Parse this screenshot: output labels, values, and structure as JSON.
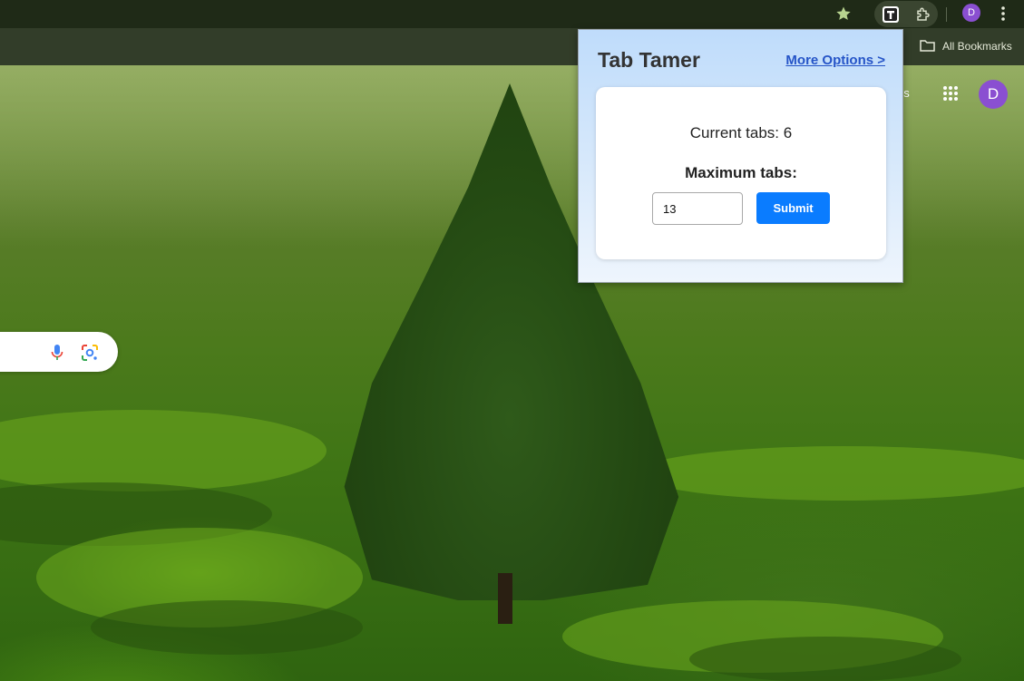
{
  "browser": {
    "bookmarks_label": "All Bookmarks",
    "images_link_fragment": "es",
    "profile_initial": "D",
    "icons": [
      "star-icon",
      "tab-tamer-extension-icon",
      "puzzle-icon",
      "kebab-menu-icon",
      "folder-icon",
      "apps-grid-icon",
      "microphone-icon",
      "google-lens-icon"
    ]
  },
  "popup": {
    "title": "Tab Tamer",
    "more_options": "More Options >",
    "current_tabs": "Current tabs: 6",
    "max_label": "Maximum tabs:",
    "max_value": "13",
    "submit_label": "Submit"
  },
  "colors": {
    "accent": "#0a7cff",
    "link": "#2554c7",
    "avatar": "#8a4fd1"
  }
}
